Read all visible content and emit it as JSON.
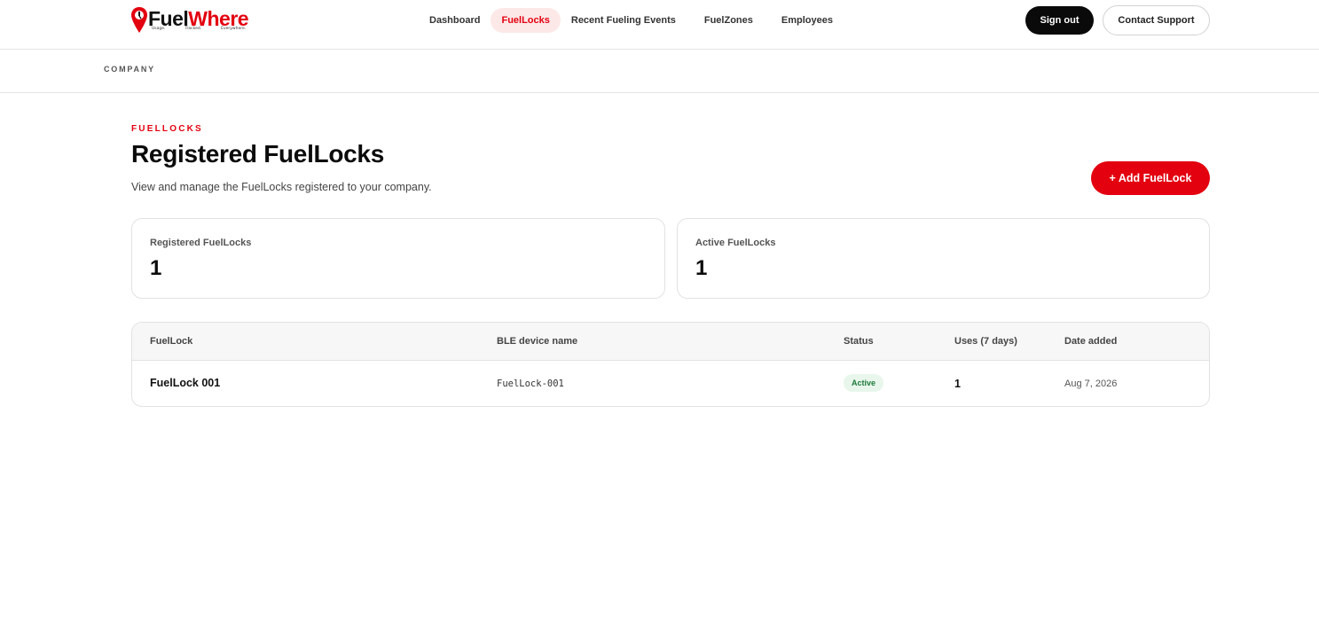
{
  "brand": {
    "name_part1": "Fuel",
    "name_part2": "Where",
    "tagline": [
      "Usage.",
      "Tracked.",
      "Everywhere."
    ],
    "accent_color": "#e3000f"
  },
  "nav": {
    "items": [
      {
        "label": "Dashboard",
        "active": false
      },
      {
        "label": "FuelLocks",
        "active": true
      },
      {
        "label": "Recent Fueling Events",
        "active": false
      },
      {
        "label": "FuelZones",
        "active": false
      },
      {
        "label": "Employees",
        "active": false
      }
    ],
    "sign_out_label": "Sign out",
    "support_label": "Contact Support"
  },
  "breadcrumb": "COMPANY",
  "header": {
    "eyebrow": "FUELLOCKS",
    "title": "Registered FuelLocks",
    "subtitle": "View and manage the FuelLocks registered to your company.",
    "add_button_label": "+ Add FuelLock"
  },
  "stats": [
    {
      "label": "Registered FuelLocks",
      "value": "1"
    },
    {
      "label": "Active FuelLocks",
      "value": "1"
    }
  ],
  "table": {
    "columns": [
      "FuelLock",
      "BLE device name",
      "Status",
      "Uses (7 days)",
      "Date added"
    ],
    "rows": [
      {
        "name": "FuelLock 001",
        "ble": "FuelLock-001",
        "status": "Active",
        "uses": "1",
        "date": "Aug 7, 2026"
      }
    ]
  }
}
